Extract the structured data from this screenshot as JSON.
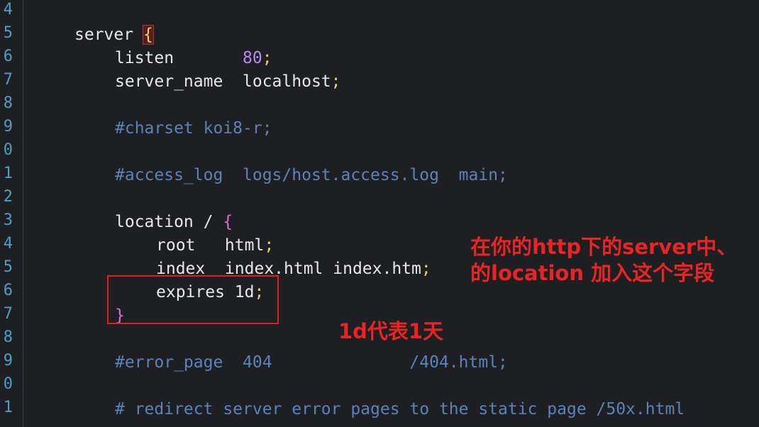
{
  "gutter": {
    "line_numbers": [
      "4",
      "5",
      "6",
      "7",
      "8",
      "9",
      "0",
      "1",
      "2",
      "3",
      "4",
      "5",
      "6",
      "7",
      "8",
      "9",
      "0",
      "1"
    ]
  },
  "code": {
    "lines": [
      {
        "tokens": []
      },
      {
        "tokens": [
          {
            "t": "server ",
            "c": "kw"
          },
          {
            "t": "{",
            "c": "sym bh"
          }
        ]
      },
      {
        "tokens": [
          {
            "t": "listen       ",
            "c": "kw"
          },
          {
            "t": "80",
            "c": "num"
          },
          {
            "t": ";",
            "c": "sym"
          }
        ]
      },
      {
        "tokens": [
          {
            "t": "server_name  localhost",
            "c": "kw"
          },
          {
            "t": ";",
            "c": "sym"
          }
        ]
      },
      {
        "tokens": []
      },
      {
        "tokens": [
          {
            "t": "#charset koi8-r;",
            "c": "cm"
          }
        ]
      },
      {
        "tokens": []
      },
      {
        "tokens": [
          {
            "t": "#access_log  logs/host.access.log  main;",
            "c": "cm"
          }
        ]
      },
      {
        "tokens": []
      },
      {
        "tokens": [
          {
            "t": "location / ",
            "c": "kw"
          },
          {
            "t": "{",
            "c": "bp"
          }
        ]
      },
      {
        "tokens": [
          {
            "t": "root   html",
            "c": "kw"
          },
          {
            "t": ";",
            "c": "sym"
          }
        ]
      },
      {
        "tokens": [
          {
            "t": "index  index.html index.htm",
            "c": "kw"
          },
          {
            "t": ";",
            "c": "sym"
          }
        ]
      },
      {
        "tokens": [
          {
            "t": "expires 1d",
            "c": "kw"
          },
          {
            "t": ";",
            "c": "sym"
          }
        ]
      },
      {
        "tokens": [
          {
            "t": "}",
            "c": "bp"
          }
        ]
      },
      {
        "tokens": []
      },
      {
        "tokens": [
          {
            "t": "#error_page  404              /404.html;",
            "c": "cm"
          }
        ]
      },
      {
        "tokens": []
      },
      {
        "tokens": [
          {
            "t": "# redirect server error pages to the static page /50x.html",
            "c": "cm"
          }
        ]
      }
    ]
  },
  "annotations": {
    "main_line1": "在你的http下的server中、",
    "main_line2": "的location 加入这个字段",
    "one_day": "1d代表1天"
  }
}
